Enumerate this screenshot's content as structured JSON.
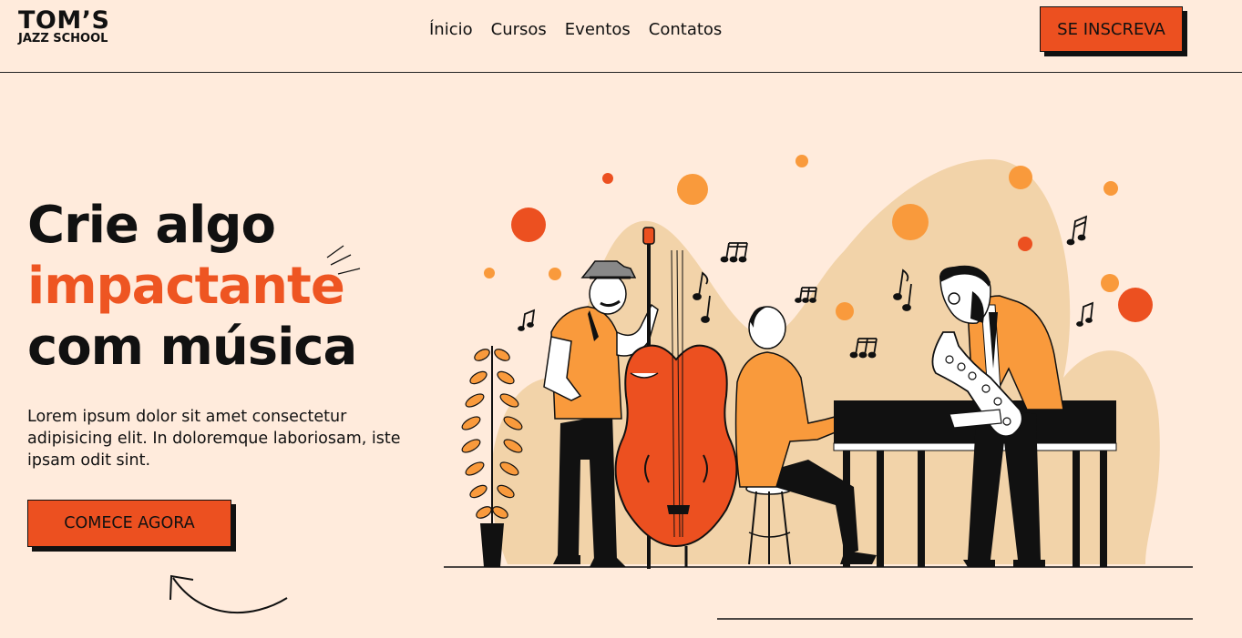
{
  "header": {
    "logo_main": "TOM’S",
    "logo_sub": "JAZZ SCHOOL",
    "nav": [
      "Ínicio",
      "Cursos",
      "Eventos",
      "Contatos"
    ],
    "cta_label": "SE INSCREVA"
  },
  "hero": {
    "title_line1": "Crie algo",
    "title_accent": "impactante",
    "title_line3": "com música",
    "description": "Lorem ipsum dolor sit amet consectetur adipisicing elit. In doloremque laboriosam, iste ipsam odit sint.",
    "cta_label": "COMECE AGORA"
  },
  "colors": {
    "background": "#ffebdc",
    "accent": "#ec5020",
    "orange_light": "#f99a3c",
    "blob": "#f2d3a9",
    "ink": "#111111"
  }
}
